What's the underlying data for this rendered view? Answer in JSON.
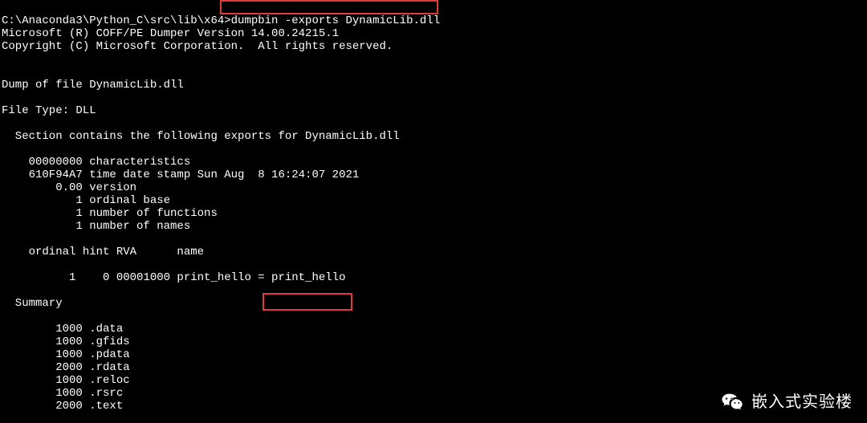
{
  "terminal": {
    "line01": "C:\\Anaconda3\\Python_C\\src\\lib\\x64>dumpbin -exports DynamicLib.dll",
    "line02": "Microsoft (R) COFF/PE Dumper Version 14.00.24215.1",
    "line03": "Copyright (C) Microsoft Corporation.  All rights reserved.",
    "line04": "",
    "line05": "",
    "line06": "Dump of file DynamicLib.dll",
    "line07": "",
    "line08": "File Type: DLL",
    "line09": "",
    "line10": "  Section contains the following exports for DynamicLib.dll",
    "line11": "",
    "line12": "    00000000 characteristics",
    "line13": "    610F94A7 time date stamp Sun Aug  8 16:24:07 2021",
    "line14": "        0.00 version",
    "line15": "           1 ordinal base",
    "line16": "           1 number of functions",
    "line17": "           1 number of names",
    "line18": "",
    "line19": "    ordinal hint RVA      name",
    "line20": "",
    "line21": "          1    0 00001000 print_hello = print_hello",
    "line22": "",
    "line23": "  Summary",
    "line24": "",
    "line25": "        1000 .data",
    "line26": "        1000 .gfids",
    "line27": "        1000 .pdata",
    "line28": "        2000 .rdata",
    "line29": "        1000 .reloc",
    "line30": "        1000 .rsrc",
    "line31": "        2000 .text"
  },
  "highlights": {
    "command": "dumpbin -exports DynamicLib.dll",
    "export_name": "print_hello"
  },
  "watermark": {
    "text": "嵌入式实验楼"
  }
}
